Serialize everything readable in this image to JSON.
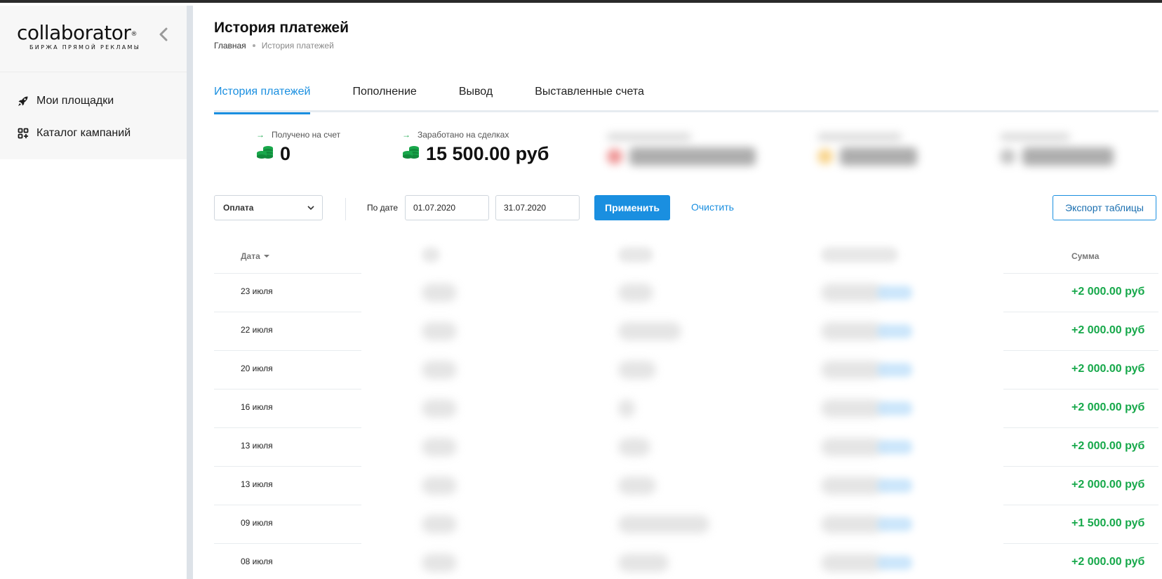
{
  "brand": {
    "name": "collaborator",
    "registered": "®",
    "tagline": "БИРЖА ПРЯМОЙ РЕКЛАМЫ"
  },
  "sidebar": {
    "items": [
      {
        "label": "Мои площадки",
        "icon": "rocket-icon"
      },
      {
        "label": "Каталог кампаний",
        "icon": "grid-plus-icon"
      }
    ]
  },
  "header": {
    "title": "История платежей",
    "breadcrumb": [
      "Главная",
      "История платежей"
    ]
  },
  "tabs": [
    {
      "label": "История платежей",
      "active": true
    },
    {
      "label": "Пополнение",
      "active": false
    },
    {
      "label": "Вывод",
      "active": false
    },
    {
      "label": "Выставленные счета",
      "active": false
    }
  ],
  "stats": [
    {
      "label": "Получено на счет",
      "value": "0"
    },
    {
      "label": "Заработано на сделках",
      "value": "15 500.00 руб"
    }
  ],
  "filters": {
    "type_selected": "Оплата",
    "by_date_label": "По дате",
    "date_from": "01.07.2020",
    "date_to": "31.07.2020",
    "apply_label": "Применить",
    "clear_label": "Очистить",
    "export_label": "Экспорт таблицы"
  },
  "table": {
    "columns": {
      "date": "Дата",
      "sum": "Сумма"
    },
    "rows": [
      {
        "date": "23 июля",
        "sum": "+2 000.00 руб"
      },
      {
        "date": "22 июля",
        "sum": "+2 000.00 руб"
      },
      {
        "date": "20 июля",
        "sum": "+2 000.00 руб"
      },
      {
        "date": "16 июля",
        "sum": "+2 000.00 руб"
      },
      {
        "date": "13 июля",
        "sum": "+2 000.00 руб"
      },
      {
        "date": "13 июля",
        "sum": "+2 000.00 руб"
      },
      {
        "date": "09 июля",
        "sum": "+1 500.00 руб"
      },
      {
        "date": "08 июля",
        "sum": "+2 000.00 руб"
      }
    ]
  },
  "colors": {
    "accent": "#1a8fe0",
    "positive": "#16a84a"
  }
}
